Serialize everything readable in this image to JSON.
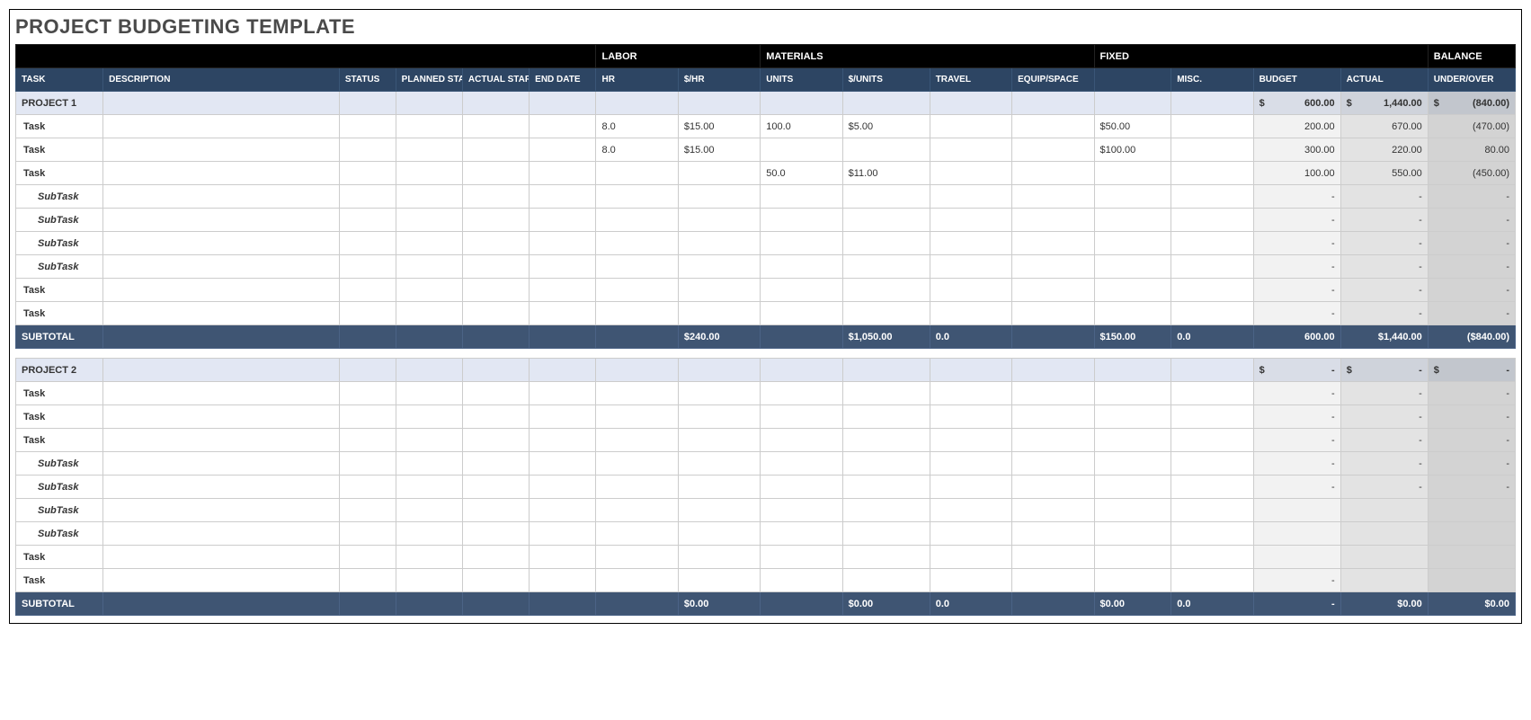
{
  "title": "PROJECT BUDGETING TEMPLATE",
  "band": {
    "labor": "LABOR",
    "materials": "MATERIALS",
    "fixed": "FIXED",
    "balance": "BALANCE"
  },
  "headers": {
    "task": "TASK",
    "description": "DESCRIPTION",
    "status": "STATUS",
    "planned_start": "PLANNED START DATE",
    "actual_start": "ACTUAL START DATE",
    "end_date": "END DATE",
    "hr": "HR",
    "rate": "$/HR",
    "units": "UNITS",
    "unit_price": "$/UNITS",
    "travel": "TRAVEL",
    "equip": "EQUIP/SPACE",
    "fixed": "",
    "misc": "MISC.",
    "budget": "BUDGET",
    "actual": "ACTUAL",
    "underover": "UNDER/OVER"
  },
  "labels": {
    "task": "Task",
    "subtask": "SubTask",
    "subtotal": "SUBTOTAL",
    "dash": "-"
  },
  "p1": {
    "name": "PROJECT 1",
    "budget_prefix": "$",
    "budget": "600.00",
    "actual_prefix": "$",
    "actual": "1,440.00",
    "uo_prefix": "$",
    "uo": "(840.00)",
    "r1": {
      "hr": "8.0",
      "rate": "$15.00",
      "units": "100.0",
      "uprice": "$5.00",
      "fixed": "$50.00",
      "budget": "200.00",
      "actual": "670.00",
      "uo": "(470.00)"
    },
    "r2": {
      "hr": "8.0",
      "rate": "$15.00",
      "fixed": "$100.00",
      "budget": "300.00",
      "actual": "220.00",
      "uo": "80.00"
    },
    "r3": {
      "units": "50.0",
      "uprice": "$11.00",
      "budget": "100.00",
      "actual": "550.00",
      "uo": "(450.00)"
    },
    "sub": {
      "rate": "$240.00",
      "uprice": "$1,050.00",
      "travel": "0.0",
      "fixed": "$150.00",
      "misc": "0.0",
      "budget": "600.00",
      "actual": "$1,440.00",
      "uo": "($840.00)"
    }
  },
  "p2": {
    "name": "PROJECT 2",
    "budget_prefix": "$",
    "budget": "-",
    "actual_prefix": "$",
    "actual": "-",
    "uo_prefix": "$",
    "uo": "-",
    "sub": {
      "rate": "$0.00",
      "uprice": "$0.00",
      "travel": "0.0",
      "fixed": "$0.00",
      "misc": "0.0",
      "budget": "-",
      "actual": "$0.00",
      "uo": "$0.00"
    }
  }
}
